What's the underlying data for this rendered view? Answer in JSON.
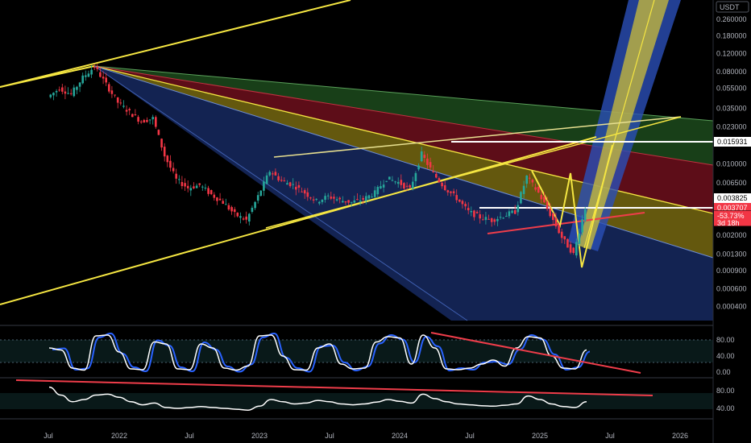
{
  "chart_data": {
    "type": "candlestick",
    "currency_label": "USDT",
    "y_scale": "log",
    "y_ticks": [
      "0.260000",
      "0.180000",
      "0.120000",
      "0.080000",
      "0.055000",
      "0.035000",
      "0.023000",
      "0.010000",
      "0.006500",
      "0.002000",
      "0.001300",
      "0.000900",
      "0.000600",
      "0.000400"
    ],
    "x_ticks": [
      "Jul",
      "2022",
      "Jul",
      "2023",
      "Jul",
      "2024",
      "Jul",
      "2025",
      "Jul",
      "2026"
    ],
    "price_tags": [
      {
        "value": "0.015931",
        "bg": "#ffffff",
        "fg": "#000000"
      },
      {
        "value": "0.003825",
        "bg": "#ffffff",
        "fg": "#000000"
      },
      {
        "value": "0.003707",
        "bg": "#f23645",
        "fg": "#ffffff"
      },
      {
        "value": "-53.73%",
        "bg": "#f23645",
        "fg": "#ffffff"
      },
      {
        "value": "3d 18h",
        "bg": "#f23645",
        "fg": "#ffffff"
      }
    ],
    "price_series": [
      [
        "2021-07",
        0.045
      ],
      [
        "2021-08",
        0.055
      ],
      [
        "2021-09",
        0.048
      ],
      [
        "2021-10",
        0.07
      ],
      [
        "2021-11",
        0.09
      ],
      [
        "2021-12",
        0.06
      ],
      [
        "2022-01",
        0.04
      ],
      [
        "2022-02",
        0.032
      ],
      [
        "2022-03",
        0.026
      ],
      [
        "2022-04",
        0.028
      ],
      [
        "2022-05",
        0.012
      ],
      [
        "2022-06",
        0.007
      ],
      [
        "2022-07",
        0.0058
      ],
      [
        "2022-08",
        0.0062
      ],
      [
        "2022-09",
        0.005
      ],
      [
        "2022-10",
        0.0042
      ],
      [
        "2022-11",
        0.0032
      ],
      [
        "2022-12",
        0.0028
      ],
      [
        "2023-01",
        0.0048
      ],
      [
        "2023-02",
        0.0085
      ],
      [
        "2023-03",
        0.0068
      ],
      [
        "2023-04",
        0.0062
      ],
      [
        "2023-05",
        0.0052
      ],
      [
        "2023-06",
        0.0043
      ],
      [
        "2023-07",
        0.0048
      ],
      [
        "2023-08",
        0.0044
      ],
      [
        "2023-09",
        0.0042
      ],
      [
        "2023-10",
        0.0045
      ],
      [
        "2023-11",
        0.0052
      ],
      [
        "2023-12",
        0.0072
      ],
      [
        "2024-01",
        0.0066
      ],
      [
        "2024-02",
        0.0056
      ],
      [
        "2024-03",
        0.0125
      ],
      [
        "2024-04",
        0.008
      ],
      [
        "2024-05",
        0.0058
      ],
      [
        "2024-06",
        0.0046
      ],
      [
        "2024-07",
        0.0034
      ],
      [
        "2024-08",
        0.003
      ],
      [
        "2024-09",
        0.0028
      ],
      [
        "2024-10",
        0.0031
      ],
      [
        "2024-11",
        0.0034
      ],
      [
        "2024-12",
        0.0075
      ],
      [
        "2025-01",
        0.0052
      ],
      [
        "2025-02",
        0.0032
      ],
      [
        "2025-03",
        0.0019
      ],
      [
        "2025-04",
        0.0013
      ],
      [
        "2025-05",
        0.0037
      ]
    ],
    "oscillator_1": {
      "ticks": [
        "80.00",
        "40.00",
        "0.00"
      ],
      "range": [
        0,
        100
      ],
      "series": [
        [
          "2021-07",
          60
        ],
        [
          "2021-08",
          55
        ],
        [
          "2021-09",
          10
        ],
        [
          "2021-10",
          5
        ],
        [
          "2021-11",
          90
        ],
        [
          "2021-12",
          92
        ],
        [
          "2022-01",
          50
        ],
        [
          "2022-02",
          8
        ],
        [
          "2022-03",
          6
        ],
        [
          "2022-04",
          75
        ],
        [
          "2022-05",
          70
        ],
        [
          "2022-06",
          8
        ],
        [
          "2022-07",
          6
        ],
        [
          "2022-08",
          70
        ],
        [
          "2022-09",
          60
        ],
        [
          "2022-10",
          10
        ],
        [
          "2022-11",
          5
        ],
        [
          "2022-12",
          15
        ],
        [
          "2023-01",
          90
        ],
        [
          "2023-02",
          92
        ],
        [
          "2023-03",
          40
        ],
        [
          "2023-04",
          6
        ],
        [
          "2023-05",
          5
        ],
        [
          "2023-06",
          60
        ],
        [
          "2023-07",
          70
        ],
        [
          "2023-08",
          20
        ],
        [
          "2023-09",
          8
        ],
        [
          "2023-10",
          10
        ],
        [
          "2023-11",
          75
        ],
        [
          "2023-12",
          88
        ],
        [
          "2024-01",
          85
        ],
        [
          "2024-02",
          20
        ],
        [
          "2024-03",
          92
        ],
        [
          "2024-04",
          60
        ],
        [
          "2024-05",
          8
        ],
        [
          "2024-06",
          6
        ],
        [
          "2024-07",
          10
        ],
        [
          "2024-08",
          20
        ],
        [
          "2024-09",
          30
        ],
        [
          "2024-10",
          15
        ],
        [
          "2024-11",
          60
        ],
        [
          "2024-12",
          88
        ],
        [
          "2025-01",
          85
        ],
        [
          "2025-02",
          40
        ],
        [
          "2025-03",
          10
        ],
        [
          "2025-04",
          8
        ],
        [
          "2025-05",
          55
        ]
      ]
    },
    "oscillator_2": {
      "ticks": [
        "80.00",
        "40.00"
      ],
      "range": [
        20,
        100
      ],
      "series": [
        [
          "2021-07",
          88
        ],
        [
          "2021-08",
          70
        ],
        [
          "2021-09",
          55
        ],
        [
          "2021-10",
          60
        ],
        [
          "2021-11",
          70
        ],
        [
          "2021-12",
          72
        ],
        [
          "2022-01",
          65
        ],
        [
          "2022-02",
          55
        ],
        [
          "2022-03",
          48
        ],
        [
          "2022-04",
          52
        ],
        [
          "2022-05",
          42
        ],
        [
          "2022-06",
          40
        ],
        [
          "2022-07",
          42
        ],
        [
          "2022-08",
          44
        ],
        [
          "2022-09",
          42
        ],
        [
          "2022-10",
          40
        ],
        [
          "2022-11",
          38
        ],
        [
          "2022-12",
          36
        ],
        [
          "2023-01",
          45
        ],
        [
          "2023-02",
          60
        ],
        [
          "2023-03",
          55
        ],
        [
          "2023-04",
          50
        ],
        [
          "2023-05",
          52
        ],
        [
          "2023-06",
          58
        ],
        [
          "2023-07",
          55
        ],
        [
          "2023-08",
          50
        ],
        [
          "2023-09",
          48
        ],
        [
          "2023-10",
          50
        ],
        [
          "2023-11",
          54
        ],
        [
          "2023-12",
          60
        ],
        [
          "2024-01",
          56
        ],
        [
          "2024-02",
          52
        ],
        [
          "2024-03",
          72
        ],
        [
          "2024-04",
          62
        ],
        [
          "2024-05",
          55
        ],
        [
          "2024-06",
          50
        ],
        [
          "2024-07",
          48
        ],
        [
          "2024-08",
          46
        ],
        [
          "2024-09",
          45
        ],
        [
          "2024-10",
          47
        ],
        [
          "2024-11",
          50
        ],
        [
          "2024-12",
          68
        ],
        [
          "2025-01",
          60
        ],
        [
          "2025-02",
          50
        ],
        [
          "2025-03",
          44
        ],
        [
          "2025-04",
          42
        ],
        [
          "2025-05",
          55
        ]
      ]
    }
  },
  "colors": {
    "background": "#000000",
    "candle_up": "#26a69a",
    "candle_down": "#f23645",
    "trendline": "#f5e642",
    "red_line": "#ef3d4a",
    "blue_fan": "#1e3a8a",
    "yellow_fan": "#8a7a14",
    "red_fan": "#7a1020",
    "green_fan": "#1f4d1f",
    "osc_white": "#ffffff",
    "osc_blue": "#2962ff"
  }
}
